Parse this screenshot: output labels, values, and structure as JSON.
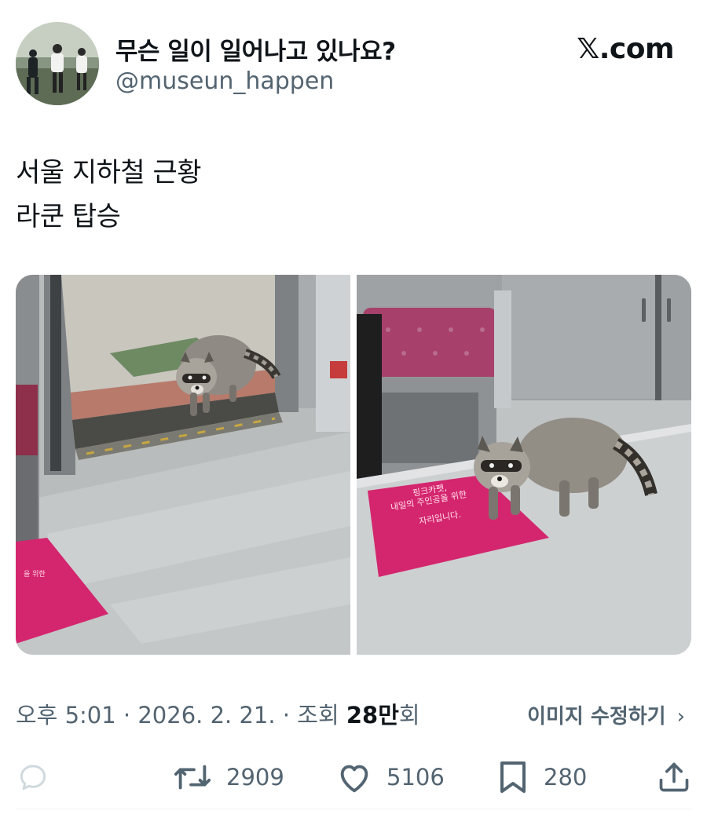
{
  "author": {
    "display_name": "무슨 일이 일어나고 있나요?",
    "handle": "@museun_happen",
    "avatar_icon": "avatar-photo"
  },
  "brand": {
    "label": "𝕏.com"
  },
  "post": {
    "lines": [
      "서울 지하철 근황",
      "라쿤 탑승"
    ]
  },
  "media": {
    "images": [
      {
        "name": "raccoon-entering-subway-door"
      },
      {
        "name": "raccoon-on-pink-floor-mat"
      }
    ],
    "mat_text": [
      "핑크카펫,",
      "내일의 주인공을 위한",
      "자리입니다."
    ]
  },
  "meta": {
    "time": "오후 5:01",
    "date": "2026. 2. 21.",
    "views_label": "조회",
    "views_number": "28만",
    "views_suffix": "회",
    "edit_image_label": "이미지 수정하기",
    "edit_chevron": "›"
  },
  "actions": {
    "reply": {
      "icon": "reply-icon",
      "count": ""
    },
    "repost": {
      "icon": "repost-icon",
      "count": "2909"
    },
    "like": {
      "icon": "heart-icon",
      "count": "5106"
    },
    "bookmark": {
      "icon": "bookmark-icon",
      "count": "280"
    },
    "share": {
      "icon": "share-icon"
    }
  },
  "colors": {
    "text_primary": "#0f1419",
    "text_secondary": "#536471",
    "pink_mat": "#d4266e"
  }
}
